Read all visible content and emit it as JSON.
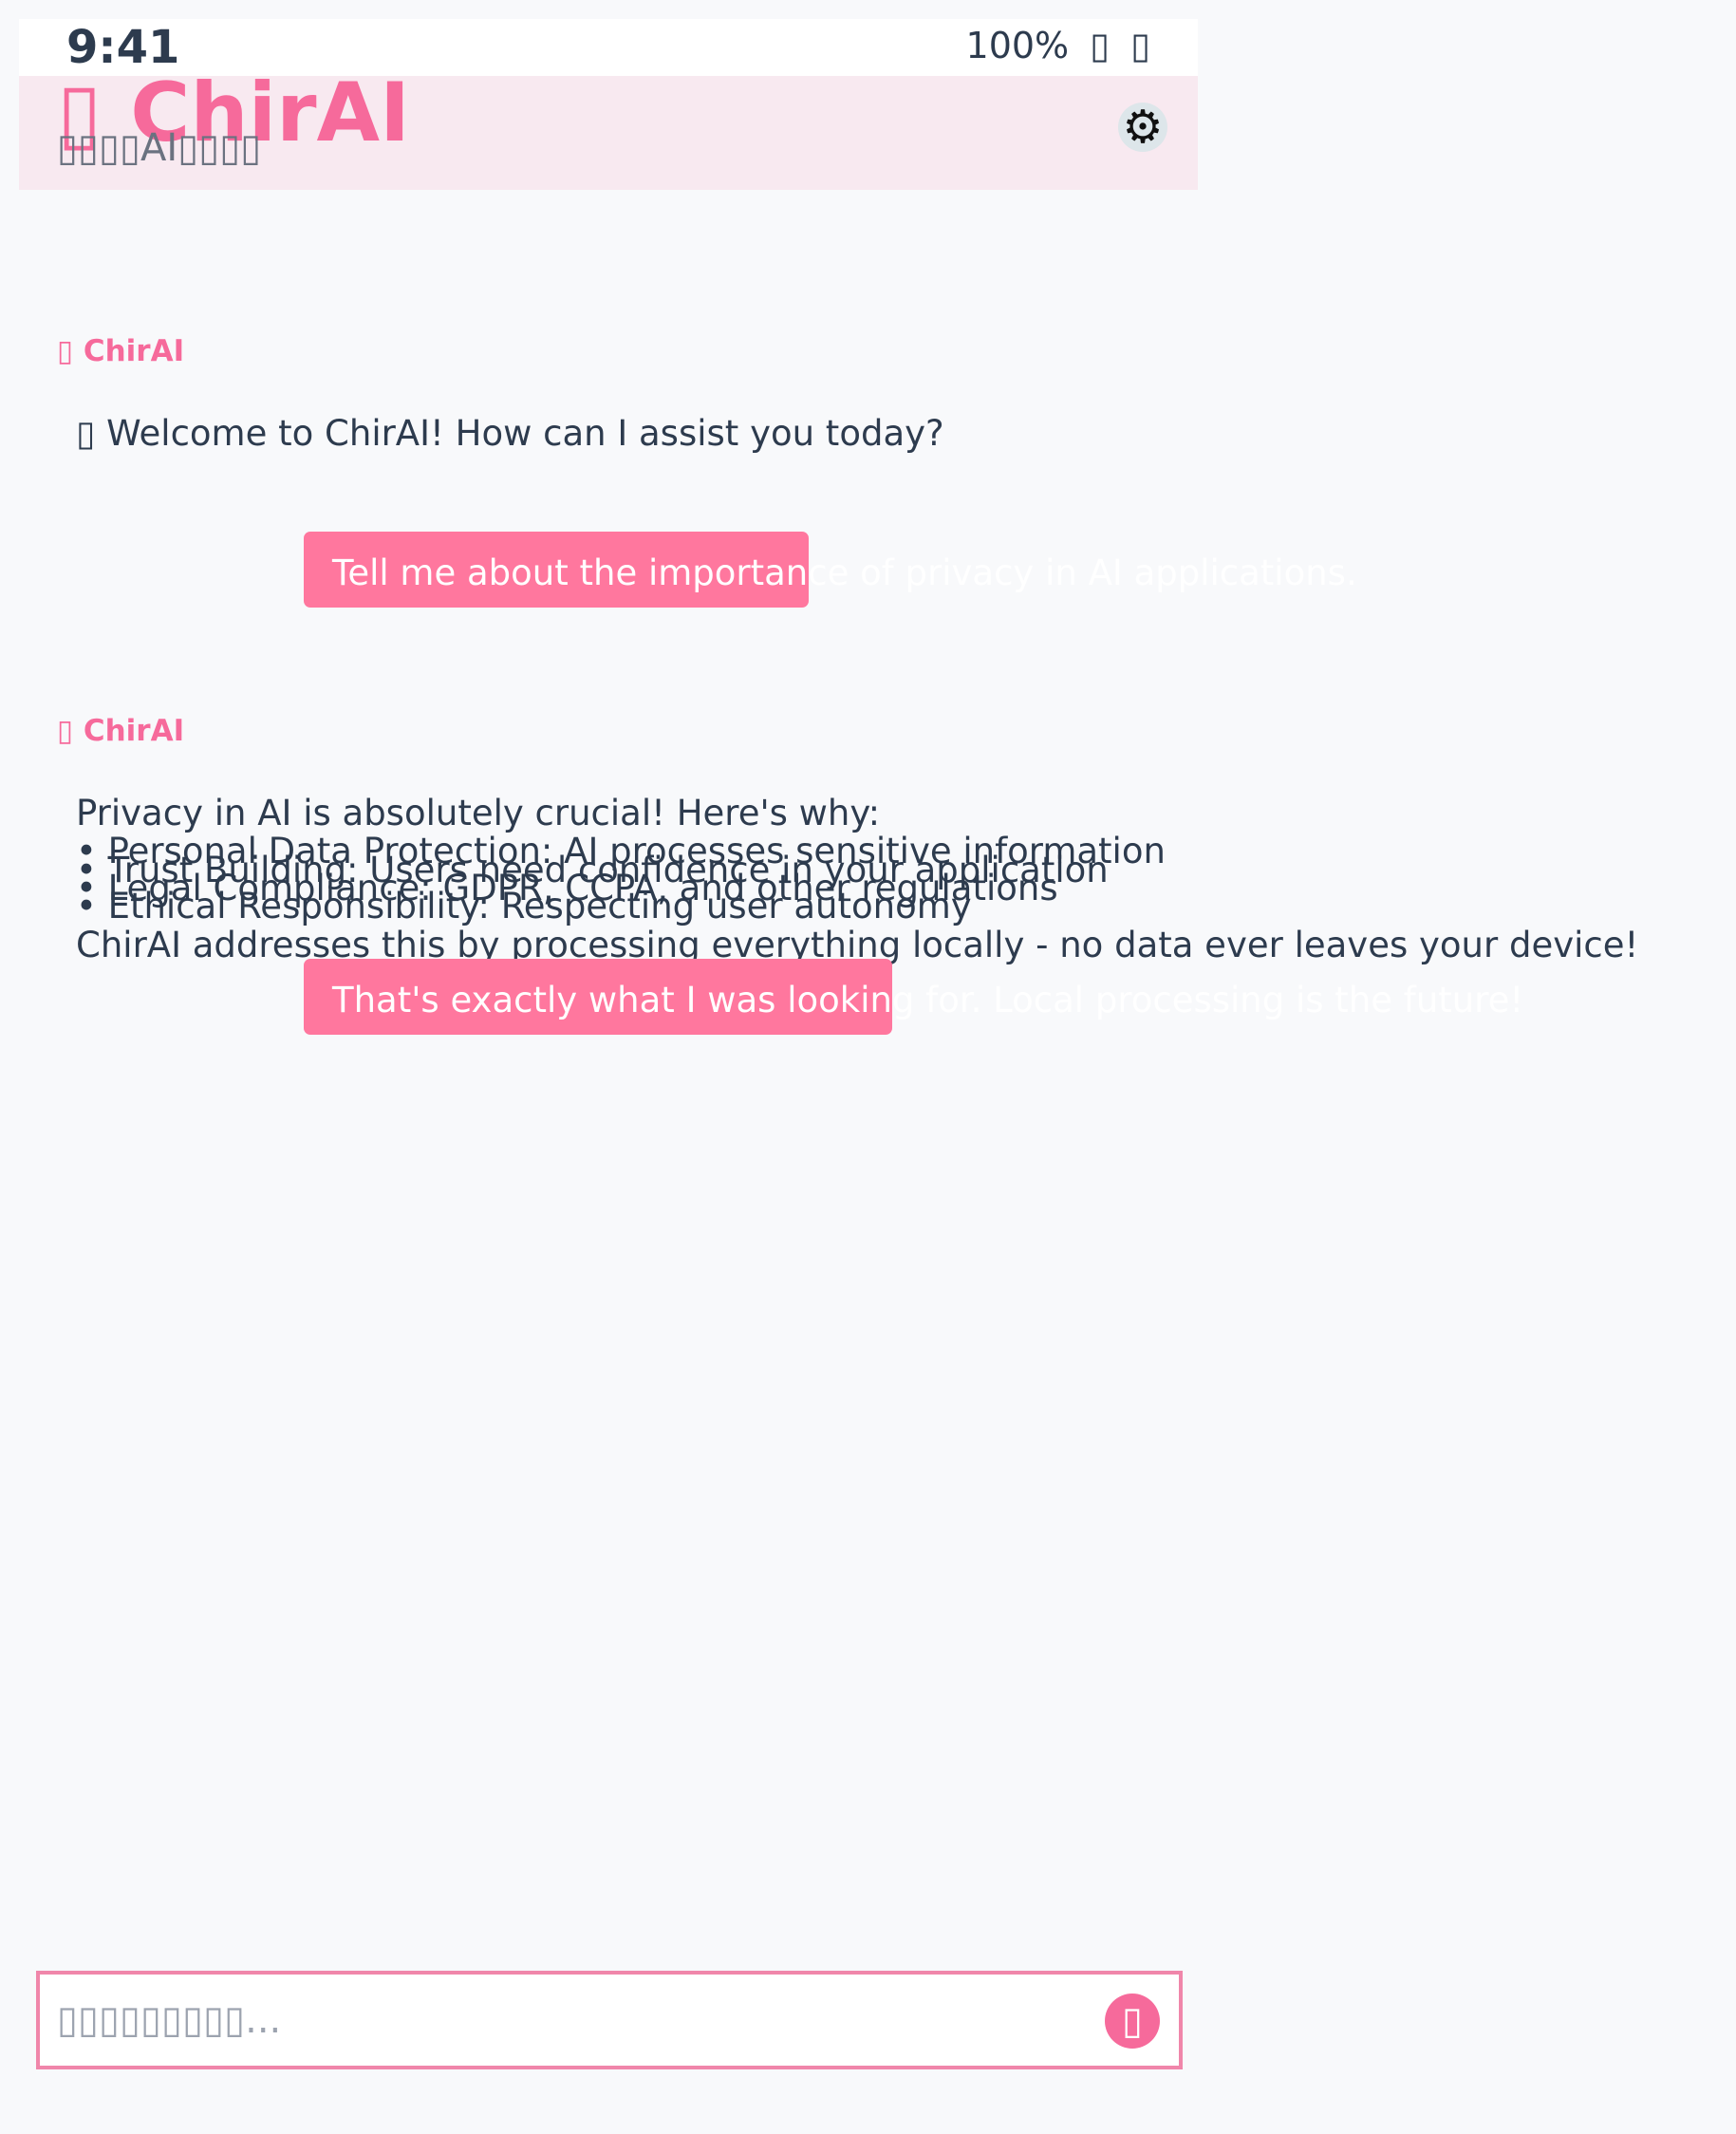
{
  "status_bar": {
    "time": "9:41",
    "battery": "100%",
    "signal_icon": "▯",
    "wifi_icon": "▯"
  },
  "header": {
    "title": "▯ ChirAI",
    "subtitle": "▯▯▯▯AI▯▯▯▯",
    "settings_icon": "⚙"
  },
  "messages": [
    {
      "role": "assistant",
      "sender": "▯ ChirAI",
      "text": "▯ Welcome to ChirAI! How can I assist you today?"
    },
    {
      "role": "user",
      "text": "Tell me about the importance of privacy in AI applications."
    },
    {
      "role": "assistant",
      "sender": "▯ ChirAI",
      "intro": "Privacy in AI is absolutely crucial! Here's why:",
      "bullets": [
        "• Personal Data Protection: AI processes sensitive information",
        "• Trust Building: Users need confidence in your application",
        "• Legal Compliance: GDPR, CCPA, and other regulations",
        "• Ethical Responsibility: Respecting user autonomy"
      ],
      "outro": "ChirAI addresses this by processing everything locally - no data ever leaves your device!"
    },
    {
      "role": "user",
      "text": "That's exactly what I was looking for. Local processing is the future!"
    }
  ],
  "input": {
    "placeholder": "▯▯▯▯▯▯▯▯▯...",
    "value": "",
    "send_icon": "▯"
  },
  "colors": {
    "accent": "#f66a9b",
    "user_bubble": "#ff779e",
    "header_bg": "#f8e9f0",
    "text": "#2d3b4e",
    "background": "#f8f9fb"
  }
}
